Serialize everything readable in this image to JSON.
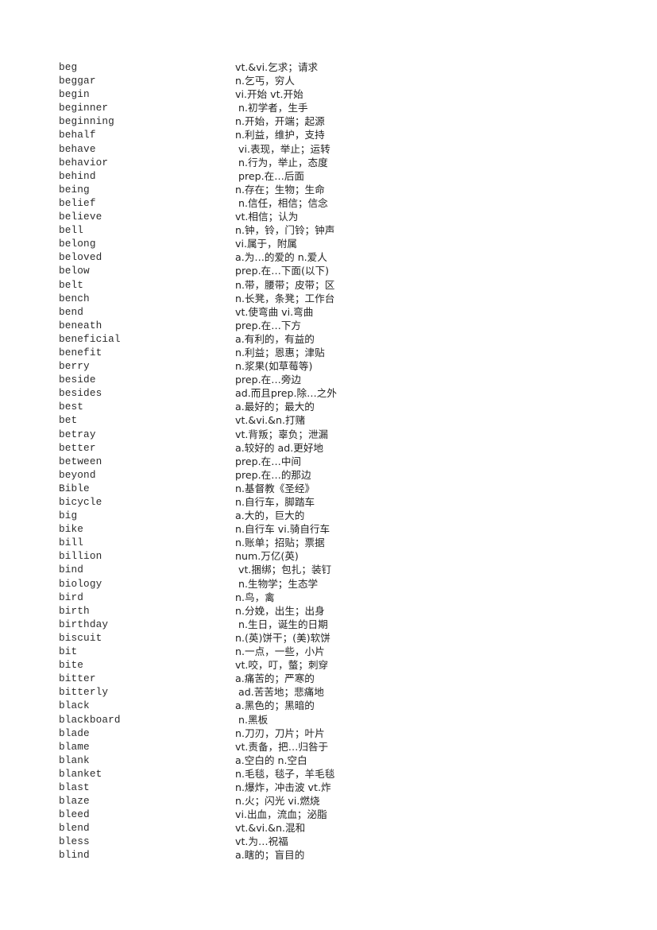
{
  "document": {
    "type": "english-chinese-vocabulary-list",
    "page_background": "#ffffff",
    "text_color": "#2b2b2b",
    "entry_count": 59,
    "first_term": "beg",
    "last_term": "blind"
  },
  "entries": [
    {
      "term": "beg",
      "definition": "vt.&vi.乞求；请求"
    },
    {
      "term": "beggar",
      "definition": "n.乞丐，穷人"
    },
    {
      "term": "begin",
      "definition": "vi.开始 vt.开始"
    },
    {
      "term": "beginner",
      "definition": " n.初学者，生手"
    },
    {
      "term": "beginning",
      "definition": "n.开始，开端；起源"
    },
    {
      "term": "behalf",
      "definition": "n.利益，维护，支持"
    },
    {
      "term": "behave",
      "definition": " vi.表现，举止；运转"
    },
    {
      "term": "behavior",
      "definition": " n.行为，举止，态度"
    },
    {
      "term": "behind",
      "definition": " prep.在…后面"
    },
    {
      "term": "being",
      "definition": "n.存在；生物；生命"
    },
    {
      "term": "belief",
      "definition": " n.信任，相信；信念"
    },
    {
      "term": "believe",
      "definition": "vt.相信；认为"
    },
    {
      "term": "bell",
      "definition": "n.钟，铃，门铃；钟声"
    },
    {
      "term": "belong",
      "definition": "vi.属于，附属"
    },
    {
      "term": "beloved",
      "definition": "a.为…的爱的 n.爱人"
    },
    {
      "term": "below",
      "definition": "prep.在…下面(以下)"
    },
    {
      "term": "belt",
      "definition": "n.带，腰带；皮带；区"
    },
    {
      "term": "bench",
      "definition": "n.长凳，条凳；工作台"
    },
    {
      "term": "bend",
      "definition": "vt.使弯曲 vi.弯曲"
    },
    {
      "term": "beneath",
      "definition": "prep.在…下方"
    },
    {
      "term": "beneficial",
      "definition": "a.有利的，有益的"
    },
    {
      "term": "benefit",
      "definition": "n.利益；恩惠；津贴"
    },
    {
      "term": "berry",
      "definition": "n.浆果(如草莓等)"
    },
    {
      "term": "beside",
      "definition": "prep.在…旁边"
    },
    {
      "term": "besides",
      "definition": "ad.而且prep.除…之外"
    },
    {
      "term": "best",
      "definition": "a.最好的；最大的"
    },
    {
      "term": "bet",
      "definition": "vt.&vi.&n.打赌"
    },
    {
      "term": "betray",
      "definition": "vt.背叛；辜负；泄漏"
    },
    {
      "term": "better",
      "definition": "a.较好的 ad.更好地"
    },
    {
      "term": "between",
      "definition": "prep.在…中间"
    },
    {
      "term": "beyond",
      "definition": "prep.在…的那边"
    },
    {
      "term": "Bible",
      "definition": "n.基督教《圣经》"
    },
    {
      "term": "bicycle",
      "definition": "n.自行车，脚踏车"
    },
    {
      "term": "big",
      "definition": "a.大的，巨大的"
    },
    {
      "term": "bike",
      "definition": "n.自行车 vi.骑自行车"
    },
    {
      "term": "bill",
      "definition": "n.账单；招贴；票据"
    },
    {
      "term": "billion",
      "definition": "num.万亿(英)"
    },
    {
      "term": "bind",
      "definition": " vt.捆绑；包扎；装钉"
    },
    {
      "term": "biology",
      "definition": " n.生物学；生态学"
    },
    {
      "term": "bird",
      "definition": "n.鸟，禽"
    },
    {
      "term": "birth",
      "definition": "n.分娩，出生；出身"
    },
    {
      "term": "birthday",
      "definition": " n.生日，诞生的日期"
    },
    {
      "term": "biscuit",
      "definition": "n.(英)饼干；(美)软饼"
    },
    {
      "term": "bit",
      "definition": "n.一点，一些，小片"
    },
    {
      "term": "bite",
      "definition": "vt.咬，叮，螫；刺穿"
    },
    {
      "term": "bitter",
      "definition": "a.痛苦的；严寒的"
    },
    {
      "term": "bitterly",
      "definition": " ad.苦苦地；悲痛地"
    },
    {
      "term": "black",
      "definition": "a.黑色的；黑暗的"
    },
    {
      "term": "blackboard",
      "definition": " n.黑板"
    },
    {
      "term": "blade",
      "definition": "n.刀刃，刀片；叶片"
    },
    {
      "term": "blame",
      "definition": "vt.责备，把…归咎于"
    },
    {
      "term": "blank",
      "definition": "a.空白的 n.空白"
    },
    {
      "term": "blanket",
      "definition": "n.毛毯，毯子，羊毛毯"
    },
    {
      "term": "blast",
      "definition": "n.爆炸，冲击波 vt.炸"
    },
    {
      "term": "blaze",
      "definition": "n.火；闪光 vi.燃烧"
    },
    {
      "term": "bleed",
      "definition": "vi.出血，流血；泌脂"
    },
    {
      "term": "blend",
      "definition": "vt.&vi.&n.混和"
    },
    {
      "term": "bless",
      "definition": "vt.为…祝福"
    },
    {
      "term": "blind",
      "definition": "a.瞎的；盲目的"
    }
  ]
}
